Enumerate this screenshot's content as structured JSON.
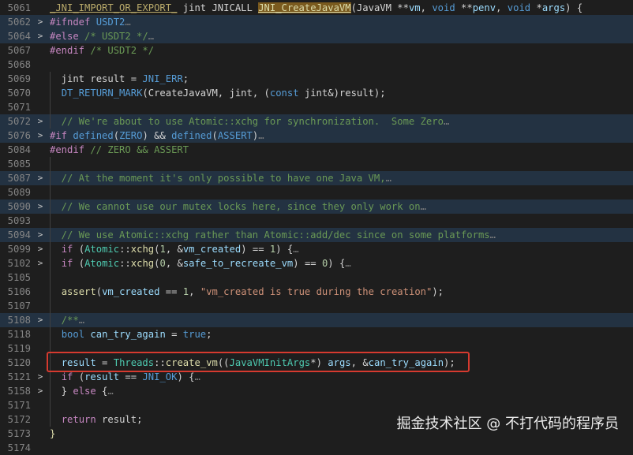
{
  "watermark": "掘金技术社区 @ 不打代码的程序员",
  "fold_chevron": ">",
  "colors": {
    "background": "#1e1e1e",
    "folded_line_bg": "#233242",
    "highlight_box": "#d63a2f"
  },
  "lines": [
    {
      "ln": "5061",
      "fold": false,
      "folded": false,
      "indent": 0,
      "tokens": [
        {
          "t": "_JNI_IMPORT_OR_EXPORT_",
          "c": "fadeu"
        },
        {
          "t": " jint ",
          "c": "plain"
        },
        {
          "t": "JNICALL",
          "c": "plain"
        },
        {
          "t": " ",
          "c": "plain"
        },
        {
          "t": "JNI_CreateJavaVM",
          "c": "fnhl"
        },
        {
          "t": "(JavaVM **",
          "c": "plain"
        },
        {
          "t": "vm",
          "c": "var"
        },
        {
          "t": ", ",
          "c": "plain"
        },
        {
          "t": "void",
          "c": "kw"
        },
        {
          "t": " **",
          "c": "plain"
        },
        {
          "t": "penv",
          "c": "var"
        },
        {
          "t": ", ",
          "c": "plain"
        },
        {
          "t": "void",
          "c": "kw"
        },
        {
          "t": " *",
          "c": "plain"
        },
        {
          "t": "args",
          "c": "var"
        },
        {
          "t": ") {",
          "c": "plain"
        }
      ]
    },
    {
      "ln": "5062",
      "fold": true,
      "folded": true,
      "indent": 0,
      "tokens": [
        {
          "t": "#ifndef",
          "c": "pp"
        },
        {
          "t": " USDT2",
          "c": "macro"
        },
        {
          "t": "…",
          "c": "ell"
        }
      ]
    },
    {
      "ln": "5064",
      "fold": true,
      "folded": true,
      "indent": 0,
      "tokens": [
        {
          "t": "#else",
          "c": "pp"
        },
        {
          "t": " /* USDT2 */",
          "c": "com"
        },
        {
          "t": "…",
          "c": "ell"
        }
      ]
    },
    {
      "ln": "5067",
      "fold": false,
      "folded": false,
      "indent": 0,
      "tokens": [
        {
          "t": "#endif",
          "c": "pp"
        },
        {
          "t": " /* USDT2 */",
          "c": "com"
        }
      ]
    },
    {
      "ln": "5068",
      "fold": false,
      "folded": false,
      "indent": 0,
      "tokens": []
    },
    {
      "ln": "5069",
      "fold": false,
      "folded": false,
      "indent": 1,
      "tokens": [
        {
          "t": "  jint ",
          "c": "plain"
        },
        {
          "t": "result",
          "c": "plain"
        },
        {
          "t": " = ",
          "c": "plain"
        },
        {
          "t": "JNI_ERR",
          "c": "kw"
        },
        {
          "t": ";",
          "c": "plain"
        }
      ]
    },
    {
      "ln": "5070",
      "fold": false,
      "folded": false,
      "indent": 1,
      "tokens": [
        {
          "t": "  ",
          "c": "plain"
        },
        {
          "t": "DT_RETURN_MARK",
          "c": "kw"
        },
        {
          "t": "(CreateJavaVM, jint, (",
          "c": "plain"
        },
        {
          "t": "const",
          "c": "kw"
        },
        {
          "t": " jint&)result);",
          "c": "plain"
        }
      ]
    },
    {
      "ln": "5071",
      "fold": false,
      "folded": false,
      "indent": 1,
      "tokens": []
    },
    {
      "ln": "5072",
      "fold": true,
      "folded": true,
      "indent": 1,
      "tokens": [
        {
          "t": "  // We're about to use Atomic::xchg for synchronization.  Some Zero",
          "c": "com"
        },
        {
          "t": "…",
          "c": "ell"
        }
      ]
    },
    {
      "ln": "5076",
      "fold": true,
      "folded": true,
      "indent": 0,
      "tokens": [
        {
          "t": "#if",
          "c": "pp"
        },
        {
          "t": " ",
          "c": "plain"
        },
        {
          "t": "defined",
          "c": "kw"
        },
        {
          "t": "(",
          "c": "plain"
        },
        {
          "t": "ZERO",
          "c": "kw"
        },
        {
          "t": ") && ",
          "c": "plain"
        },
        {
          "t": "defined",
          "c": "kw"
        },
        {
          "t": "(",
          "c": "plain"
        },
        {
          "t": "ASSERT",
          "c": "kw"
        },
        {
          "t": ")",
          "c": "plain"
        },
        {
          "t": "…",
          "c": "ell"
        }
      ]
    },
    {
      "ln": "5084",
      "fold": false,
      "folded": false,
      "indent": 0,
      "tokens": [
        {
          "t": "#endif",
          "c": "pp"
        },
        {
          "t": " // ZERO && ASSERT",
          "c": "com"
        }
      ]
    },
    {
      "ln": "5085",
      "fold": false,
      "folded": false,
      "indent": 1,
      "tokens": []
    },
    {
      "ln": "5087",
      "fold": true,
      "folded": true,
      "indent": 1,
      "tokens": [
        {
          "t": "  // At the moment it's only possible to have one Java VM,",
          "c": "com"
        },
        {
          "t": "…",
          "c": "ell"
        }
      ]
    },
    {
      "ln": "5089",
      "fold": false,
      "folded": false,
      "indent": 1,
      "tokens": []
    },
    {
      "ln": "5090",
      "fold": true,
      "folded": true,
      "indent": 1,
      "tokens": [
        {
          "t": "  // We cannot use our mutex locks here, since they only work on",
          "c": "com"
        },
        {
          "t": "…",
          "c": "ell"
        }
      ]
    },
    {
      "ln": "5093",
      "fold": false,
      "folded": false,
      "indent": 1,
      "tokens": []
    },
    {
      "ln": "5094",
      "fold": true,
      "folded": true,
      "indent": 1,
      "tokens": [
        {
          "t": "  // We use Atomic::xchg rather than Atomic::add/dec since on some platforms",
          "c": "com"
        },
        {
          "t": "…",
          "c": "ell"
        }
      ]
    },
    {
      "ln": "5099",
      "fold": true,
      "folded": false,
      "indent": 1,
      "tokens": [
        {
          "t": "  ",
          "c": "plain"
        },
        {
          "t": "if",
          "c": "ctl"
        },
        {
          "t": " (",
          "c": "plain"
        },
        {
          "t": "Atomic",
          "c": "type"
        },
        {
          "t": "::",
          "c": "plain"
        },
        {
          "t": "xchg",
          "c": "fn"
        },
        {
          "t": "(",
          "c": "plain"
        },
        {
          "t": "1",
          "c": "num"
        },
        {
          "t": ", &",
          "c": "plain"
        },
        {
          "t": "vm_created",
          "c": "var"
        },
        {
          "t": ") == ",
          "c": "plain"
        },
        {
          "t": "1",
          "c": "num"
        },
        {
          "t": ") {",
          "c": "plain"
        },
        {
          "t": "…",
          "c": "ell"
        }
      ]
    },
    {
      "ln": "5102",
      "fold": true,
      "folded": false,
      "indent": 1,
      "tokens": [
        {
          "t": "  ",
          "c": "plain"
        },
        {
          "t": "if",
          "c": "ctl"
        },
        {
          "t": " (",
          "c": "plain"
        },
        {
          "t": "Atomic",
          "c": "type"
        },
        {
          "t": "::",
          "c": "plain"
        },
        {
          "t": "xchg",
          "c": "fn"
        },
        {
          "t": "(",
          "c": "plain"
        },
        {
          "t": "0",
          "c": "num"
        },
        {
          "t": ", &",
          "c": "plain"
        },
        {
          "t": "safe_to_recreate_vm",
          "c": "var"
        },
        {
          "t": ") == ",
          "c": "plain"
        },
        {
          "t": "0",
          "c": "num"
        },
        {
          "t": ") {",
          "c": "plain"
        },
        {
          "t": "…",
          "c": "ell"
        }
      ]
    },
    {
      "ln": "5105",
      "fold": false,
      "folded": false,
      "indent": 1,
      "tokens": []
    },
    {
      "ln": "5106",
      "fold": false,
      "folded": false,
      "indent": 1,
      "tokens": [
        {
          "t": "  ",
          "c": "plain"
        },
        {
          "t": "assert",
          "c": "fn"
        },
        {
          "t": "(",
          "c": "plain"
        },
        {
          "t": "vm_created",
          "c": "var"
        },
        {
          "t": " == ",
          "c": "plain"
        },
        {
          "t": "1",
          "c": "num"
        },
        {
          "t": ", ",
          "c": "plain"
        },
        {
          "t": "\"vm_created is true during the creation\"",
          "c": "str"
        },
        {
          "t": ");",
          "c": "plain"
        }
      ]
    },
    {
      "ln": "5107",
      "fold": false,
      "folded": false,
      "indent": 1,
      "tokens": []
    },
    {
      "ln": "5108",
      "fold": true,
      "folded": true,
      "indent": 1,
      "tokens": [
        {
          "t": "  /**",
          "c": "com"
        },
        {
          "t": "…",
          "c": "ell"
        }
      ]
    },
    {
      "ln": "5118",
      "fold": false,
      "folded": false,
      "indent": 1,
      "tokens": [
        {
          "t": "  ",
          "c": "plain"
        },
        {
          "t": "bool",
          "c": "kw"
        },
        {
          "t": " ",
          "c": "plain"
        },
        {
          "t": "can_try_again",
          "c": "var"
        },
        {
          "t": " = ",
          "c": "plain"
        },
        {
          "t": "true",
          "c": "kw"
        },
        {
          "t": ";",
          "c": "plain"
        }
      ]
    },
    {
      "ln": "5119",
      "fold": false,
      "folded": false,
      "indent": 1,
      "tokens": []
    },
    {
      "ln": "5120",
      "fold": false,
      "folded": false,
      "indent": 1,
      "tokens": [
        {
          "t": "  ",
          "c": "plain"
        },
        {
          "t": "result",
          "c": "var"
        },
        {
          "t": " = ",
          "c": "plain"
        },
        {
          "t": "Threads",
          "c": "type"
        },
        {
          "t": "::",
          "c": "plain"
        },
        {
          "t": "create_vm",
          "c": "fn"
        },
        {
          "t": "((",
          "c": "plain"
        },
        {
          "t": "JavaVMInitArgs",
          "c": "type"
        },
        {
          "t": "*) ",
          "c": "plain"
        },
        {
          "t": "args",
          "c": "var"
        },
        {
          "t": ", &",
          "c": "plain"
        },
        {
          "t": "can_try_again",
          "c": "var"
        },
        {
          "t": ");",
          "c": "plain"
        }
      ]
    },
    {
      "ln": "5121",
      "fold": true,
      "folded": false,
      "indent": 1,
      "tokens": [
        {
          "t": "  ",
          "c": "plain"
        },
        {
          "t": "if",
          "c": "ctl"
        },
        {
          "t": " (",
          "c": "plain"
        },
        {
          "t": "result",
          "c": "var"
        },
        {
          "t": " == ",
          "c": "plain"
        },
        {
          "t": "JNI_OK",
          "c": "kw"
        },
        {
          "t": ") {",
          "c": "plain"
        },
        {
          "t": "…",
          "c": "ell"
        }
      ]
    },
    {
      "ln": "5158",
      "fold": true,
      "folded": false,
      "indent": 1,
      "tokens": [
        {
          "t": "  } ",
          "c": "plain"
        },
        {
          "t": "else",
          "c": "ctl"
        },
        {
          "t": " {",
          "c": "plain"
        },
        {
          "t": "…",
          "c": "ell"
        }
      ]
    },
    {
      "ln": "5171",
      "fold": false,
      "folded": false,
      "indent": 1,
      "tokens": []
    },
    {
      "ln": "5172",
      "fold": false,
      "folded": false,
      "indent": 1,
      "tokens": [
        {
          "t": "  ",
          "c": "plain"
        },
        {
          "t": "return",
          "c": "ctl"
        },
        {
          "t": " result;",
          "c": "plain"
        }
      ]
    },
    {
      "ln": "5173",
      "fold": false,
      "folded": false,
      "indent": 0,
      "tokens": [
        {
          "t": "}",
          "c": "fn"
        }
      ]
    },
    {
      "ln": "5174",
      "fold": false,
      "folded": false,
      "indent": 0,
      "tokens": []
    }
  ]
}
